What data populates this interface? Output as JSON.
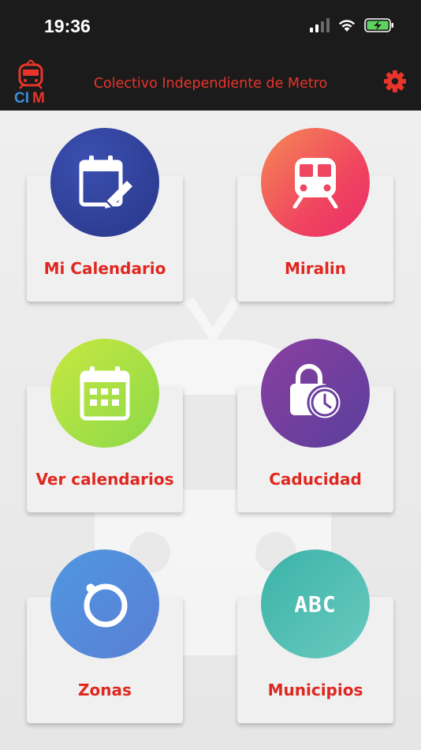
{
  "status_bar": {
    "time": "19:36"
  },
  "header": {
    "logo_text": "CIM",
    "title": "Colectivo Independiente de Metro",
    "settings_icon": "gear-icon"
  },
  "colors": {
    "header_bg": "#1b1b1b",
    "accent": "#e8342a",
    "card_bg": "#f0f0f0"
  },
  "menu": [
    {
      "label": "Mi Calendario",
      "icon": "calendar-edit-icon"
    },
    {
      "label": "Miralin",
      "icon": "train-icon"
    },
    {
      "label": "Ver calendarios",
      "icon": "calendar-grid-icon"
    },
    {
      "label": "Caducidad",
      "icon": "lock-clock-icon"
    },
    {
      "label": "Zonas",
      "icon": "ring-icon"
    },
    {
      "label": "Municipios",
      "icon": "abc-icon",
      "icon_text": "ABC"
    }
  ]
}
